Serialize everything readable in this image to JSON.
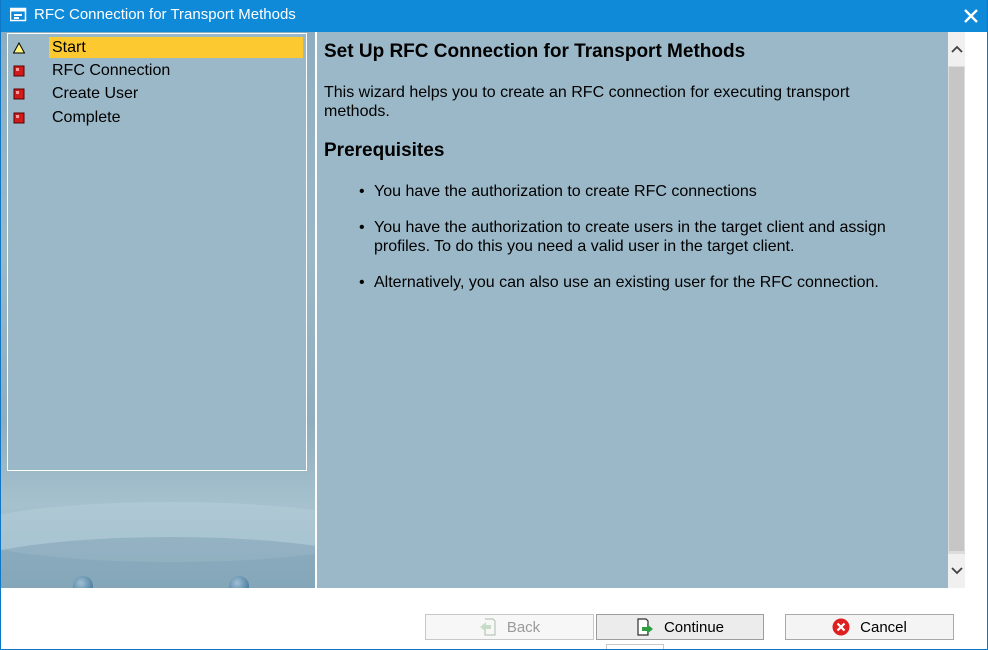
{
  "window": {
    "title": "RFC Connection for Transport Methods"
  },
  "nav": {
    "items": [
      {
        "label": "Start",
        "status": "warning",
        "active": true
      },
      {
        "label": "RFC Connection",
        "status": "incomplete",
        "active": false
      },
      {
        "label": "Create User",
        "status": "incomplete",
        "active": false
      },
      {
        "label": "Complete",
        "status": "incomplete",
        "active": false
      }
    ]
  },
  "content": {
    "title": "Set Up RFC Connection for Transport Methods",
    "intro": "This wizard helps you to create an RFC connection for executing transport methods.",
    "prerequisites_heading": "Prerequisites",
    "bullet_char": "•",
    "prerequisites": [
      "You have the authorization to create RFC connections",
      "You have the authorization to create users in the target client and assign profiles. To do this you need a valid user in the target client.",
      "Alternatively, you can also use an existing user for the RFC connection."
    ]
  },
  "buttons": {
    "back_label": "Back",
    "continue_label": "Continue",
    "cancel_label": "Cancel"
  },
  "colors": {
    "titlebar": "#0f8ad9",
    "panel_background": "#9bb8c8",
    "active_highlight": "#fdc930",
    "incomplete_marker": "#d11a1a",
    "cancel_icon": "#e02020",
    "continue_icon": "#2e9e3e"
  }
}
